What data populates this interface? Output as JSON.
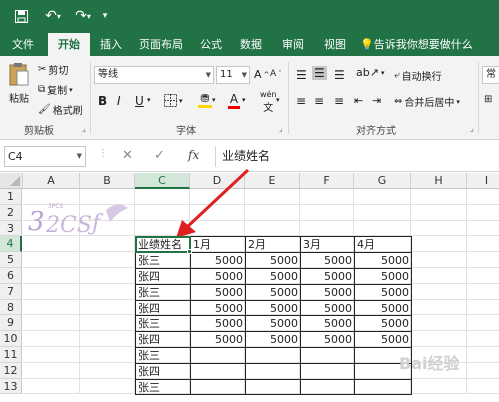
{
  "quick_access": {
    "save_icon": "save-icon",
    "undo_icon": "undo-icon",
    "redo_icon": "redo-icon",
    "customize_icon": "customize-icon"
  },
  "tabs": [
    "文件",
    "开始",
    "插入",
    "页面布局",
    "公式",
    "数据",
    "审阅",
    "视图"
  ],
  "active_tab": "开始",
  "tell_me": "告诉我你想要做什么",
  "ribbon": {
    "clipboard": {
      "paste": "粘贴",
      "cut": "剪切",
      "copy": "复制",
      "format_painter": "格式刷",
      "label": "剪贴板"
    },
    "font": {
      "name": "等线",
      "size": "11",
      "grow": "A",
      "shrink": "A",
      "bold": "B",
      "italic": "I",
      "underline": "U",
      "wen": "wén",
      "wen_char": "文",
      "font_color": "A",
      "label": "字体"
    },
    "alignment": {
      "wrap": "自动换行",
      "merge": "合并后居中",
      "label": "对齐方式"
    },
    "number": {
      "format": "常"
    }
  },
  "formula_bar": {
    "name_box": "C4",
    "fx": "fx",
    "content": "业绩姓名"
  },
  "columns": [
    "A",
    "B",
    "C",
    "D",
    "E",
    "F",
    "G",
    "H",
    "I"
  ],
  "rows": [
    "1",
    "2",
    "3",
    "4",
    "5",
    "6",
    "7",
    "8",
    "9",
    "10",
    "11",
    "12",
    "13"
  ],
  "selected_column": "C",
  "selected_row": "4",
  "table": {
    "headers": [
      "业绩姓名",
      "1月",
      "2月",
      "3月",
      "4月"
    ],
    "rows": [
      [
        "张三",
        "5000",
        "5000",
        "5000",
        "5000"
      ],
      [
        "张四",
        "5000",
        "5000",
        "5000",
        "5000"
      ],
      [
        "张三",
        "5000",
        "5000",
        "5000",
        "5000"
      ],
      [
        "张四",
        "5000",
        "5000",
        "5000",
        "5000"
      ],
      [
        "张三",
        "5000",
        "5000",
        "5000",
        "5000"
      ],
      [
        "张四",
        "5000",
        "5000",
        "5000",
        "5000"
      ],
      [
        "张三",
        "",
        "",
        "",
        ""
      ],
      [
        "张四",
        "",
        "",
        "",
        ""
      ],
      [
        "张三",
        "",
        "",
        "",
        ""
      ]
    ]
  },
  "colors": {
    "excel_green": "#217346",
    "arrow": "#e02020"
  }
}
